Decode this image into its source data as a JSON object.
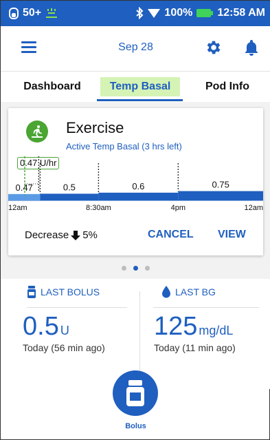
{
  "status_bar": {
    "battery_text": "50+",
    "battery_pct": "100%",
    "time": "12:58 AM"
  },
  "header": {
    "date": "Sep 28",
    "icons": [
      "menu-icon",
      "gear-icon",
      "bell-icon"
    ]
  },
  "tabs": [
    {
      "label": "Dashboard",
      "active": false
    },
    {
      "label": "Temp Basal",
      "active": true
    },
    {
      "label": "Pod Info",
      "active": false
    }
  ],
  "temp_basal_card": {
    "title": "Exercise",
    "subtitle": "Active Temp Basal (3 hrs left)",
    "current_rate": "0.47 U/hr",
    "decrease_label": "Decrease",
    "decrease_value": "5%",
    "cancel_label": "CANCEL",
    "view_label": "VIEW"
  },
  "chart_data": {
    "type": "step",
    "x_ticks": [
      "12am",
      "8:30am",
      "4pm",
      "12am"
    ],
    "segments": [
      {
        "start_hr": 0,
        "end_hr": 3,
        "rate": 0.47,
        "label": "0.47",
        "temp": true
      },
      {
        "start_hr": 3,
        "end_hr": 8.5,
        "rate": 0.5,
        "label": "0.5"
      },
      {
        "start_hr": 8.5,
        "end_hr": 16,
        "rate": 0.6,
        "label": "0.6"
      },
      {
        "start_hr": 16,
        "end_hr": 24,
        "rate": 0.75,
        "label": "0.75"
      }
    ],
    "colors": {
      "bar": "#1f5fbf",
      "temp_bar": "#5b9be6",
      "temp_outline": "#4aa532"
    }
  },
  "pager": {
    "count": 3,
    "active_index": 1
  },
  "last_bolus": {
    "label": "LAST BOLUS",
    "value": "0.5",
    "unit": "U",
    "ago": "Today (56 min ago)"
  },
  "last_bg": {
    "label": "LAST BG",
    "value": "125",
    "unit": "mg/dL",
    "ago": "Today (11 min ago)"
  },
  "bolus_button": {
    "label": "Bolus"
  },
  "colors": {
    "primary": "#1f5fbf",
    "accent_green": "#4aa532",
    "tab_highlight": "#d4f3b5"
  }
}
